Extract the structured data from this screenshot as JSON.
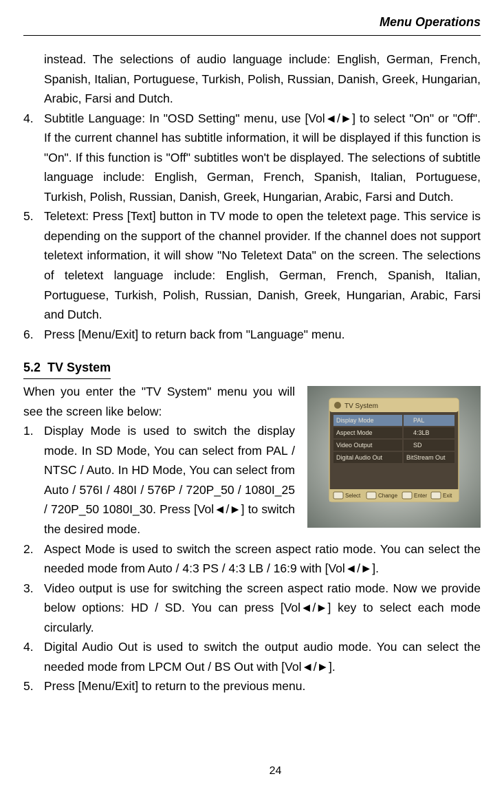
{
  "header": {
    "title": "Menu Operations"
  },
  "top_paragraph": "instead. The selections of audio language include: English, German, French, Spanish, Italian, Portuguese, Turkish, Polish, Russian, Danish, Greek, Hungarian, Arabic, Farsi and Dutch.",
  "upper_list": [
    {
      "num": "4.",
      "text": "Subtitle Language: In \"OSD Setting\" menu, use [Vol◄/►] to select \"On\" or \"Off\". If the current channel has subtitle information, it will be displayed if this function is \"On\". If this function is \"Off\" subtitles won't be displayed. The selections of subtitle language include: English, German, French, Spanish, Italian, Portuguese, Turkish, Polish, Russian, Danish, Greek, Hungarian, Arabic, Farsi and Dutch."
    },
    {
      "num": "5.",
      "text": "Teletext: Press [Text] button in TV mode to open the teletext page. This service is depending on the support of the channel provider. If the channel does not support teletext information, it will show \"No Teletext Data\" on the screen. The selections of teletext language include: English, German, French, Spanish, Italian, Portuguese, Turkish, Polish, Russian, Danish, Greek, Hungarian, Arabic, Farsi and Dutch."
    },
    {
      "num": "6.",
      "text": "Press [Menu/Exit] to return back from \"Language\" menu."
    }
  ],
  "section": {
    "number": "5.2",
    "title": "TV  System"
  },
  "tv_intro": "When you enter the \"TV System\" menu you will see the screen like below:",
  "tv_list_wrap": [
    {
      "num": "1.",
      "text": "Display Mode is used to switch the display mode. In SD Mode, You can select from PAL / NTSC / Auto. In HD Mode, You can select from Auto / 576I / 480I / 576P / 720P_50 / 1080I_25 / 720P_50 1080I_30. Press [Vol◄/►] to switch the desired mode."
    }
  ],
  "tv_list_full": [
    {
      "num": "2.",
      "text": "Aspect Mode is used to switch the screen aspect ratio mode. You can select the needed mode from Auto / 4:3 PS / 4:3 LB / 16:9 with [Vol◄/►]."
    },
    {
      "num": "3.",
      "text": "Video output is use for switching the screen aspect ratio mode. Now we provide below options: HD / SD. You can press [Vol◄/►] key to select each mode circularly."
    },
    {
      "num": "4.",
      "text": "Digital Audio Out is used to switch the output audio mode. You can select the needed mode from LPCM Out / BS Out with [Vol◄/►]."
    },
    {
      "num": "5.",
      "text": "Press [Menu/Exit] to return to the previous menu."
    }
  ],
  "screenshot": {
    "title": "TV System",
    "rows": [
      {
        "label": "Display Mode",
        "value": "PAL"
      },
      {
        "label": "Aspect Mode",
        "value": "4:3LB"
      },
      {
        "label": "Video Output",
        "value": "SD"
      },
      {
        "label": "Digital Audio Out",
        "value": "BitStream Out"
      }
    ],
    "footer": [
      "Select",
      "Change",
      "Enter",
      "Exit"
    ]
  },
  "page_number": "24"
}
